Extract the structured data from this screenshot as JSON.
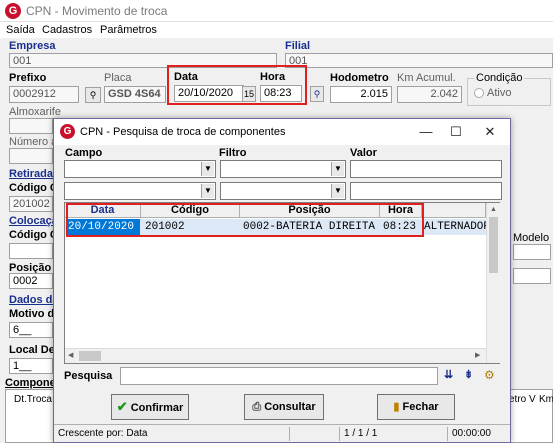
{
  "main_window": {
    "title": "CPN - Movimento de troca",
    "menu": [
      "Saída",
      "Cadastros",
      "Parâmetros"
    ],
    "empresa": {
      "label": "Empresa",
      "value": "001"
    },
    "filial": {
      "label": "Filial",
      "value": "001"
    },
    "prefixo": {
      "label": "Prefixo",
      "value": "0002912"
    },
    "placa": {
      "label": "Placa",
      "value": "GSD 4S64"
    },
    "data": {
      "label": "Data",
      "value": "20/10/2020"
    },
    "hora": {
      "label": "Hora",
      "value": "08:23"
    },
    "hodometro": {
      "label": "Hodometro",
      "value": "2.015"
    },
    "km_acumul": {
      "label": "Km Acumul.",
      "value": "2.042"
    },
    "condicao": {
      "label": "Condição",
      "value": "Ativo"
    },
    "almoxarife": {
      "label": "Almoxarife"
    },
    "numero_au": {
      "label": "Número au"
    },
    "retirada": {
      "label": "Retirada"
    },
    "codigo_co_1": {
      "label": "Código Co",
      "value": "201002"
    },
    "colocacao": {
      "label": "Colocação"
    },
    "codigo_co_2": {
      "label": "Código Co"
    },
    "modelo": {
      "label": "Modelo"
    },
    "posicao": {
      "label": "Posição",
      "value": "0002"
    },
    "dados_da": {
      "label": "Dados da"
    },
    "motivo_da": {
      "label": "Motivo da",
      "value": "6__"
    },
    "local_des": {
      "label": "Local Des",
      "value": "1__"
    },
    "componen": {
      "label": "Componen"
    },
    "dt_troca": {
      "label": "Dt.Troca"
    },
    "right_col_labels": {
      "a": "etro V",
      "b": "Km"
    }
  },
  "dialog": {
    "title": "CPN - Pesquisa de troca de componentes",
    "campo_label": "Campo",
    "filtro_label": "Filtro",
    "valor_label": "Valor",
    "columns": [
      "Data",
      "Código Componente",
      "Posição",
      "Hora"
    ],
    "rows": [
      {
        "data": "20/10/2020",
        "codigo": "201002",
        "posicao": "0002-BATERIA DIREITA",
        "hora": "08:23",
        "extra": "ALTERNADOR"
      }
    ],
    "pesquisa_label": "Pesquisa",
    "pesquisa_value": "",
    "confirmar": "Confirmar",
    "consultar": "Consultar",
    "fechar": "Fechar",
    "status_sort": "Crescente por: Data",
    "status_count": "1 / 1 / 1",
    "status_time": "00:00:00"
  },
  "colors": {
    "accent_red": "#e0201f",
    "selection_blue": "#0078d7",
    "label_blue": "#1a2f8c"
  }
}
